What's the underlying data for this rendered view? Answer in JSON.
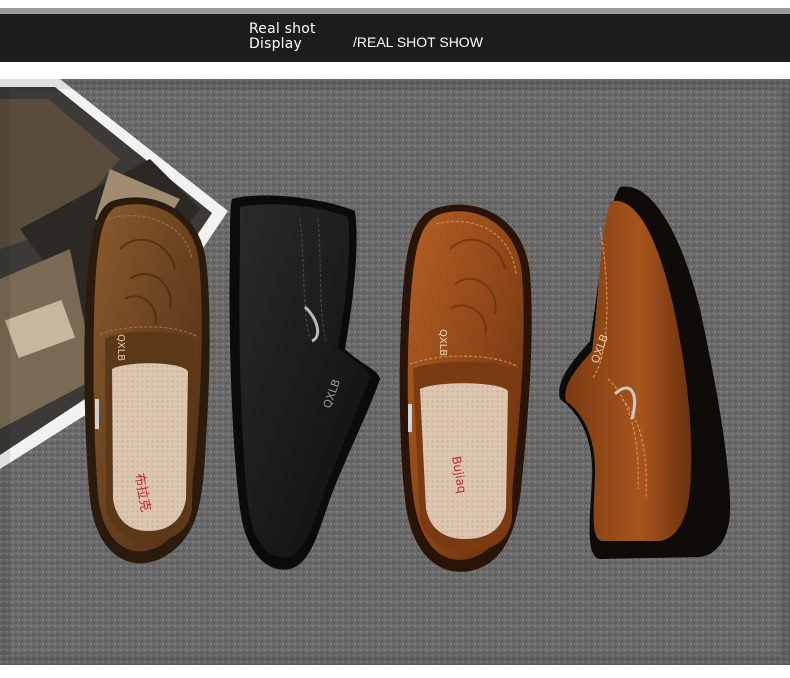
{
  "banner": {
    "title_line1": "Real shot",
    "title_line2": "Display",
    "subtitle": "/REAL SHOT SHOW"
  },
  "photo": {
    "brand_mark": "QXLB",
    "insole_brand_cn": "布拉克",
    "insole_brand_en": "Bujiaq"
  },
  "colors": {
    "banner_bg": "#1c1c1c",
    "carpet": "#6e6e6e",
    "dark_brown": "#6b4420",
    "light_brown": "#9a4e1c",
    "black_shoe": "#151515",
    "insole": "#d8c3ad"
  }
}
